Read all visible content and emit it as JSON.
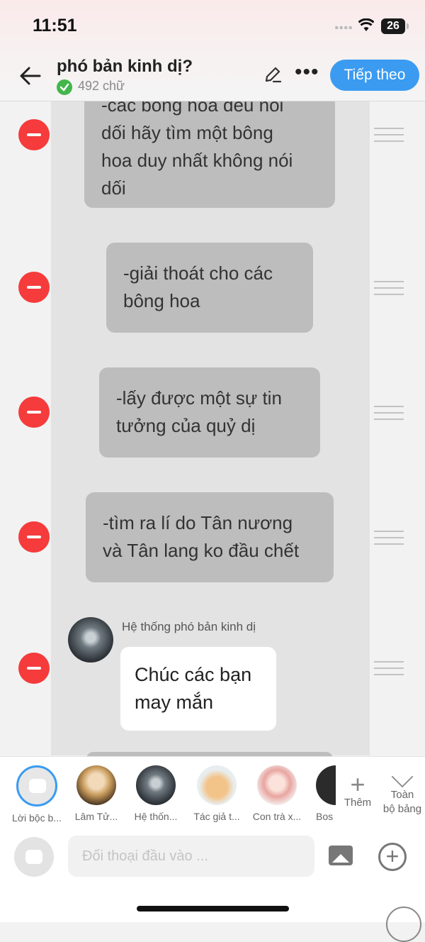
{
  "status_bar": {
    "time": "11:51",
    "battery": "26"
  },
  "header": {
    "title": "phó bản kinh dị?",
    "word_count": "492 chữ",
    "next_button": "Tiếp theo"
  },
  "messages": [
    {
      "text": "-các bông hoa đều nói\ndối hãy tìm một bông\nhoa duy nhất không nói\ndối"
    },
    {
      "text": "-giải thoát cho các\nbông hoa"
    },
    {
      "text": "-lấy được một sự tin\ntưởng của quỷ dị"
    },
    {
      "text": "-tìm ra lí do Tân nương\nvà Tân lang ko đầu chết"
    },
    {
      "speaker": "Hệ thống phó bản kinh dị",
      "text": "Chúc các bạn\nmay mắn"
    }
  ],
  "characters": [
    {
      "label": "Lời bộc b..."
    },
    {
      "label": "Lâm Tử..."
    },
    {
      "label": "Hệ thốn..."
    },
    {
      "label": "Tác giả t..."
    },
    {
      "label": "Con trà x..."
    },
    {
      "label": "Bos"
    }
  ],
  "add_role_label": "Thêm",
  "collapse_label": "Toàn\nbộ bảng",
  "input": {
    "placeholder": "Đối thoại đầu vào ..."
  },
  "colors": {
    "accent": "#3a9bf1",
    "remove": "#f53b3b",
    "bubble": "#bdbdbd"
  }
}
